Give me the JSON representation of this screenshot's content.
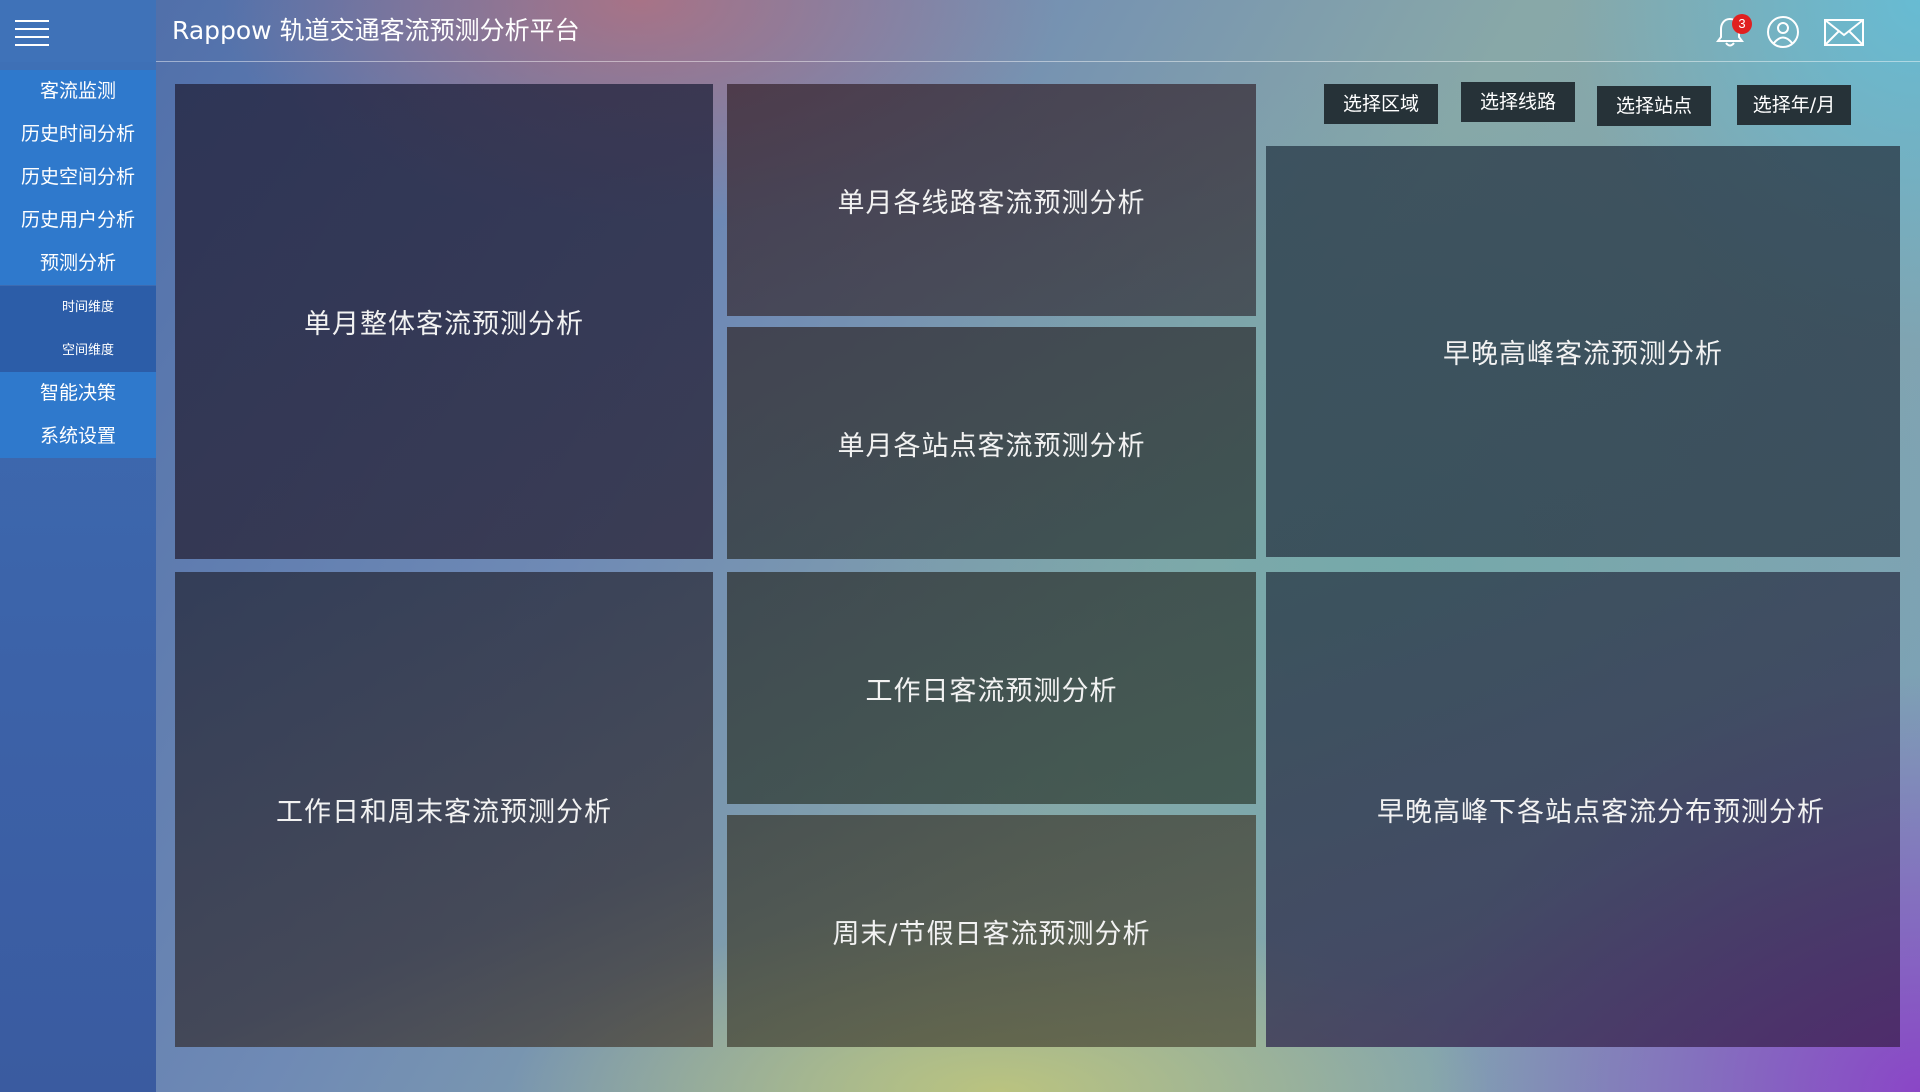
{
  "header": {
    "title": "Rappow 轨道交通客流预测分析平台",
    "notification_count": "3",
    "icons": [
      "menu-icon",
      "bell-icon",
      "user-icon",
      "mail-icon"
    ]
  },
  "sidebar": {
    "items": [
      {
        "label": "客流监测"
      },
      {
        "label": "历史时间分析"
      },
      {
        "label": "历史空间分析"
      },
      {
        "label": "历史用户分析"
      },
      {
        "label": "预测分析"
      },
      {
        "label": "时间维度"
      },
      {
        "label": "空间维度"
      },
      {
        "label": "智能决策"
      },
      {
        "label": "系统设置"
      }
    ]
  },
  "selectors": {
    "region": "选择区域",
    "line": "选择线路",
    "station": "选择站点",
    "year_month": "选择年/月"
  },
  "panels": {
    "monthly_overall": "单月整体客流预测分析",
    "monthly_lines": "单月各线路客流预测分析",
    "monthly_stations": "单月各站点客流预测分析",
    "peak_hours": "早晚高峰客流预测分析",
    "workday_weekend": "工作日和周末客流预测分析",
    "workday": "工作日客流预测分析",
    "weekend_holiday": "周末/节假日客流预测分析",
    "peak_stations": "早晚高峰下各站点客流分布预测分析"
  },
  "colors": {
    "sidebar_item": "#2f79cc",
    "sidebar_sub_item": "#2c5da8",
    "selector_button": "#263238",
    "badge": "#e02020"
  }
}
